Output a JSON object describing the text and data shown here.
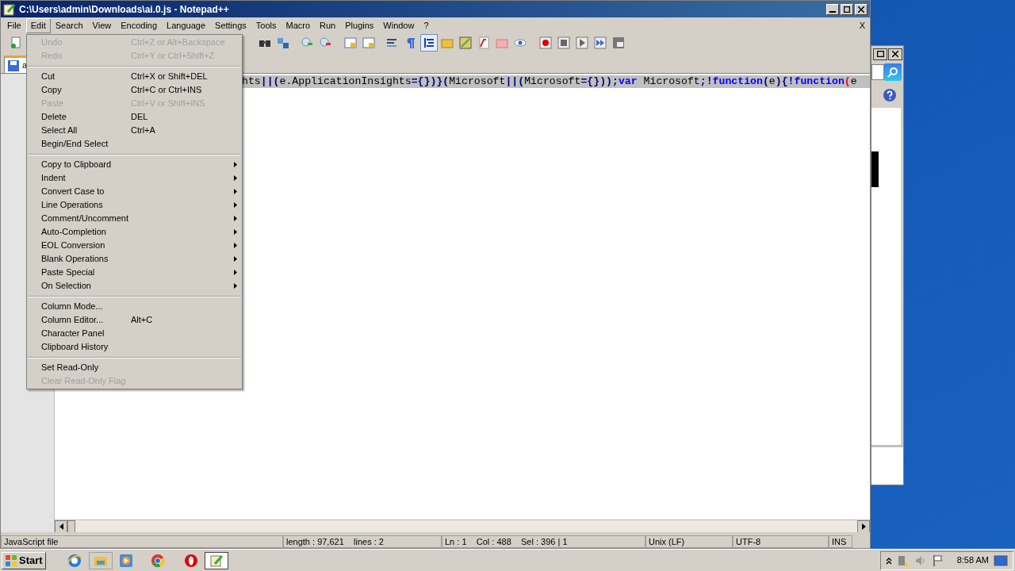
{
  "window": {
    "title": "C:\\Users\\admin\\Downloads\\ai.0.js - Notepad++"
  },
  "menu_bar": [
    {
      "label": "File",
      "selected": false
    },
    {
      "label": "Edit",
      "selected": true
    },
    {
      "label": "Search",
      "selected": false
    },
    {
      "label": "View",
      "selected": false
    },
    {
      "label": "Encoding",
      "selected": false
    },
    {
      "label": "Language",
      "selected": false
    },
    {
      "label": "Settings",
      "selected": false
    },
    {
      "label": "Tools",
      "selected": false
    },
    {
      "label": "Macro",
      "selected": false
    },
    {
      "label": "Run",
      "selected": false
    },
    {
      "label": "Plugins",
      "selected": false
    },
    {
      "label": "Window",
      "selected": false
    },
    {
      "label": "?",
      "selected": false
    }
  ],
  "close_document": "X",
  "edit_menu": [
    {
      "kind": "item",
      "label": "Undo",
      "shortcut": "Ctrl+Z or Alt+Backspace",
      "disabled": true
    },
    {
      "kind": "item",
      "label": "Redo",
      "shortcut": "Ctrl+Y or Ctrl+Shift+Z",
      "disabled": true
    },
    {
      "kind": "separator"
    },
    {
      "kind": "item",
      "label": "Cut",
      "shortcut": "Ctrl+X or Shift+DEL",
      "disabled": false
    },
    {
      "kind": "item",
      "label": "Copy",
      "shortcut": "Ctrl+C or Ctrl+INS",
      "disabled": false
    },
    {
      "kind": "item",
      "label": "Paste",
      "shortcut": "Ctrl+V or Shift+INS",
      "disabled": true
    },
    {
      "kind": "item",
      "label": "Delete",
      "shortcut": "DEL",
      "disabled": false
    },
    {
      "kind": "item",
      "label": "Select All",
      "shortcut": "Ctrl+A",
      "disabled": false
    },
    {
      "kind": "item",
      "label": "Begin/End Select",
      "disabled": false
    },
    {
      "kind": "separator"
    },
    {
      "kind": "submenu",
      "label": "Copy to Clipboard",
      "disabled": false
    },
    {
      "kind": "submenu",
      "label": "Indent",
      "disabled": false
    },
    {
      "kind": "submenu",
      "label": "Convert Case to",
      "disabled": false
    },
    {
      "kind": "submenu",
      "label": "Line Operations",
      "disabled": false
    },
    {
      "kind": "submenu",
      "label": "Comment/Uncomment",
      "disabled": false
    },
    {
      "kind": "submenu",
      "label": "Auto-Completion",
      "disabled": false
    },
    {
      "kind": "submenu",
      "label": "EOL Conversion",
      "disabled": false
    },
    {
      "kind": "submenu",
      "label": "Blank Operations",
      "disabled": false
    },
    {
      "kind": "submenu",
      "label": "Paste Special",
      "disabled": false
    },
    {
      "kind": "submenu",
      "label": "On Selection",
      "disabled": false
    },
    {
      "kind": "separator"
    },
    {
      "kind": "item",
      "label": "Column Mode...",
      "disabled": false
    },
    {
      "kind": "item",
      "label": "Column Editor...",
      "shortcut": "Alt+C",
      "disabled": false
    },
    {
      "kind": "item",
      "label": "Character Panel",
      "disabled": false
    },
    {
      "kind": "item",
      "label": "Clipboard History",
      "disabled": false
    },
    {
      "kind": "separator"
    },
    {
      "kind": "item",
      "label": "Set Read-Only",
      "disabled": false
    },
    {
      "kind": "item",
      "label": "Clear Read-Only Flag",
      "disabled": true
    }
  ],
  "tab": {
    "label": "a"
  },
  "editor": {
    "line_1": [
      {
        "kind": "plain",
        "text": "hts"
      },
      {
        "kind": "operator",
        "text": "||("
      },
      {
        "kind": "plain",
        "text": "e.ApplicationInsights"
      },
      {
        "kind": "operator",
        "text": "={})}("
      },
      {
        "kind": "plain",
        "text": "Microsoft"
      },
      {
        "kind": "operator",
        "text": "||("
      },
      {
        "kind": "plain",
        "text": "Microsoft"
      },
      {
        "kind": "operator",
        "text": "={}));"
      },
      {
        "kind": "keyword",
        "text": "var"
      },
      {
        "kind": "plain",
        "text": " Microsoft"
      },
      {
        "kind": "operator",
        "text": ";!"
      },
      {
        "kind": "keyword",
        "text": "function"
      },
      {
        "kind": "operator",
        "text": "("
      },
      {
        "kind": "plain",
        "text": "e"
      },
      {
        "kind": "operator",
        "text": "){!"
      },
      {
        "kind": "keyword",
        "text": "function"
      },
      {
        "kind": "bracket",
        "text": "("
      },
      {
        "kind": "plain",
        "text": "e"
      }
    ]
  },
  "status_bar": [
    {
      "text": "JavaScript file"
    },
    {
      "text": "length : 97,621    lines : 2"
    },
    {
      "text": "Ln : 1    Col : 488    Sel : 396 | 1"
    },
    {
      "text": "Unix (LF)"
    },
    {
      "text": "UTF-8"
    },
    {
      "text": "INS"
    }
  ],
  "taskbar": {
    "start": "Start",
    "clock": "8:58 AM"
  }
}
